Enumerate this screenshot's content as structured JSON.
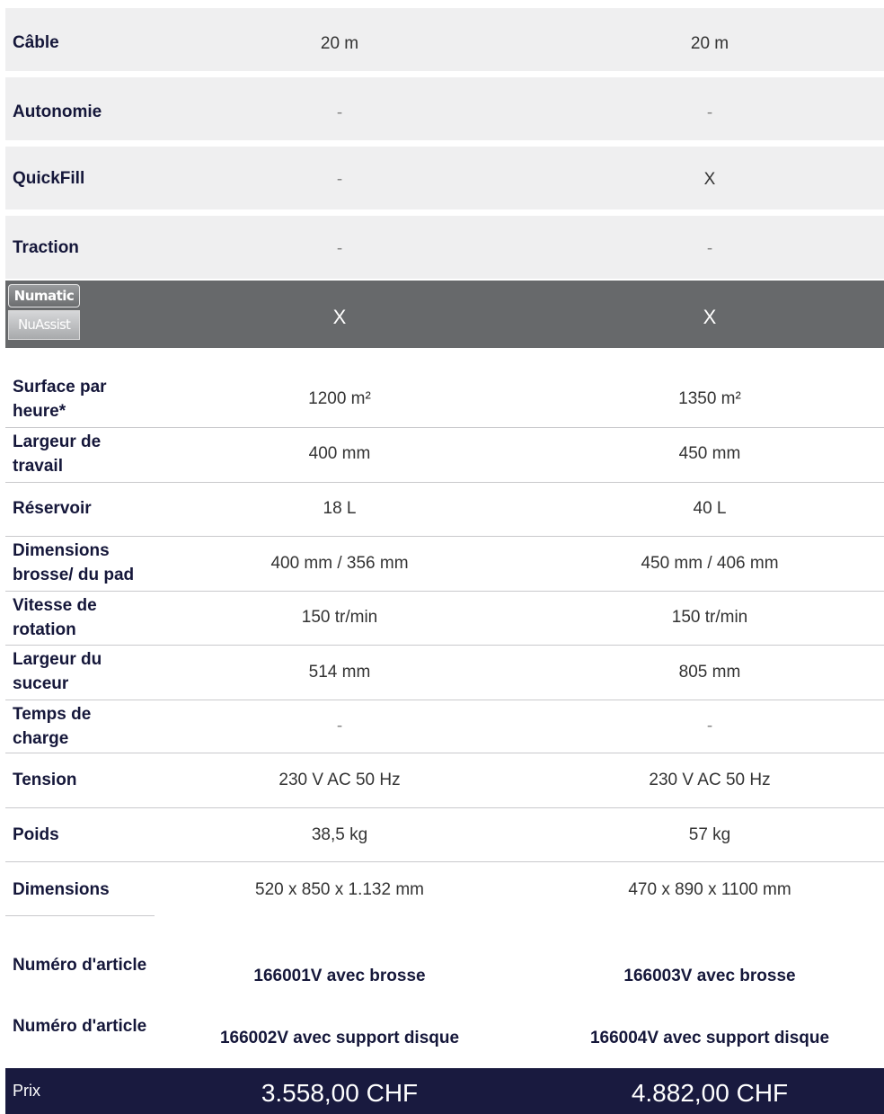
{
  "features": [
    {
      "label": "Câble",
      "col1": "20 m",
      "col2": "20 m"
    },
    {
      "label": "Autonomie",
      "col1": "-",
      "col2": "-"
    },
    {
      "label": "QuickFill",
      "col1": "-",
      "col2": "X"
    },
    {
      "label": "Traction",
      "col1": "-",
      "col2": "-"
    }
  ],
  "nuassist": {
    "logo_top": "Numatic",
    "logo_bottom": "NuAssist",
    "col1": "X",
    "col2": "X"
  },
  "specs": [
    {
      "label": "Surface par heure*",
      "col1": "1200 m²",
      "col2": "1350 m²"
    },
    {
      "label": "Largeur de travail",
      "col1": "400 mm",
      "col2": "450 mm"
    },
    {
      "label": "Réservoir",
      "col1": "18 L",
      "col2": "40 L"
    },
    {
      "label": "Dimensions brosse/ du pad",
      "col1": "400 mm / 356 mm",
      "col2": "450 mm / 406 mm"
    },
    {
      "label": "Vitesse de rotation",
      "col1": "150 tr/min",
      "col2": "150 tr/min"
    },
    {
      "label": "Largeur du suceur",
      "col1": "514 mm",
      "col2": "805 mm"
    },
    {
      "label": "Temps de charge",
      "col1": "-",
      "col2": "-"
    },
    {
      "label": "Tension",
      "col1": "230 V AC 50 Hz",
      "col2": "230 V AC 50 Hz"
    },
    {
      "label": "Poids",
      "col1": "38,5 kg",
      "col2": "57 kg"
    },
    {
      "label": "Dimensions",
      "col1": "520 x 850 x 1.132 mm",
      "col2": "470 x 890 x 1100 mm"
    }
  ],
  "articles": [
    {
      "label": "Numéro d'article",
      "col1": "166001V avec brosse",
      "col2": "166003V avec brosse"
    },
    {
      "label": "Numéro d'article",
      "col1": "166002V avec support disque",
      "col2": "166004V avec support disque"
    }
  ],
  "price": {
    "label": "Prix",
    "col1": "3.558,00 CHF",
    "col2": "4.882,00 CHF"
  },
  "colors": {
    "feature_bg": "#efeff0",
    "assist_bg": "#67696b",
    "price_bg": "#191a3f",
    "label_text": "#15173a"
  }
}
